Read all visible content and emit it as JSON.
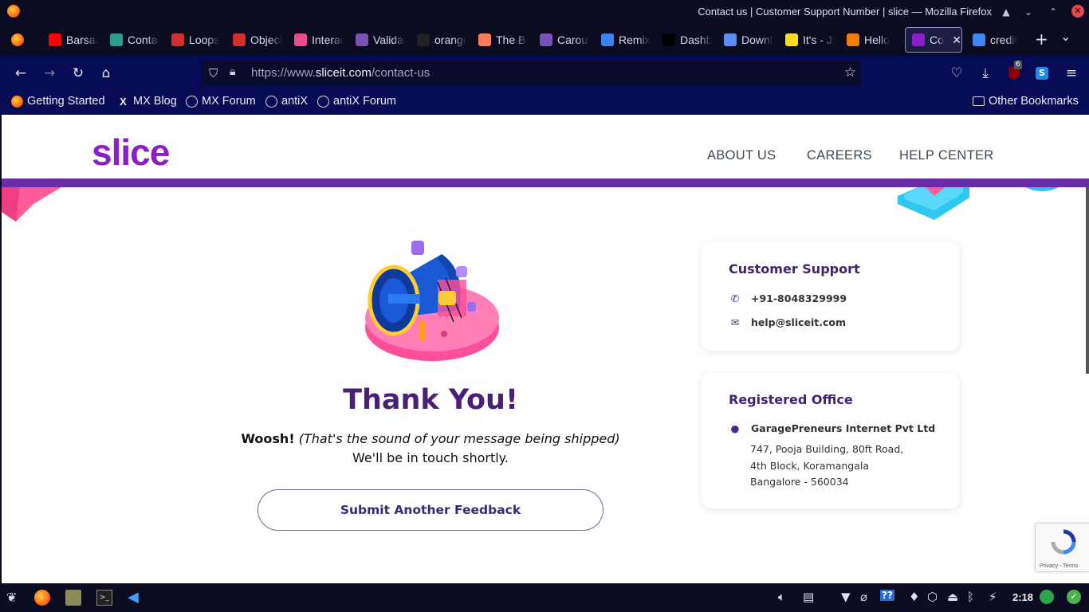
{
  "window": {
    "title": "Contact us | Customer Support Number | slice — Mozilla Firefox",
    "controls": [
      "▲",
      "⌄",
      "⌃",
      "✕"
    ]
  },
  "tabs": [
    {
      "label": "Barsaat",
      "icon": "youtube-icon",
      "color": "#ff0000"
    },
    {
      "label": "Contact",
      "icon": "document-icon",
      "color": "#2a9d8f"
    },
    {
      "label": "Loops",
      "icon": "stickman-icon",
      "color": "#d32f2f"
    },
    {
      "label": "Object",
      "icon": "stickman-icon",
      "color": "#d32f2f"
    },
    {
      "label": "Interactive",
      "icon": "dribbble-icon",
      "color": "#ea4c89"
    },
    {
      "label": "Validation",
      "icon": "bootstrap-icon",
      "color": "#7952b3"
    },
    {
      "label": "orange",
      "icon": "box-icon",
      "color": "#222222"
    },
    {
      "label": "The Best",
      "icon": "hubspot-icon",
      "color": "#ff7a59"
    },
    {
      "label": "Carousel",
      "icon": "bootstrap-icon",
      "color": "#7952b3"
    },
    {
      "label": "Remix",
      "icon": "remix-icon",
      "color": "#3b82f6"
    },
    {
      "label": "Dashboard",
      "icon": "vercel-icon",
      "color": "#000000"
    },
    {
      "label": "Download",
      "icon": "diamond-icon",
      "color": "#5b8def"
    },
    {
      "label": "It's - JS",
      "icon": "js-icon",
      "color": "#f7df1e"
    },
    {
      "label": "Hello",
      "icon": "ag-icon",
      "color": "#f57c00"
    },
    {
      "label": "Contact",
      "icon": "slice-icon",
      "color": "#8b1fc7",
      "active": true
    },
    {
      "label": "credit",
      "icon": "google-icon",
      "color": "#4285f4"
    }
  ],
  "navbar": {
    "url_prefix": "https://www.",
    "url_domain": "sliceit.com",
    "url_path": "/contact-us",
    "ublock_count": "6"
  },
  "bookmarks": [
    {
      "label": "Getting Started",
      "icon": "firefox-icon"
    },
    {
      "label": "MX Blog",
      "icon": "mx-icon"
    },
    {
      "label": "MX Forum",
      "icon": "globe-icon"
    },
    {
      "label": "antiX",
      "icon": "globe-icon"
    },
    {
      "label": "antiX Forum",
      "icon": "globe-icon"
    }
  ],
  "other_bookmarks": "Other Bookmarks",
  "site": {
    "logo": "slice",
    "nav": [
      "ABOUT US",
      "CAREERS",
      "HELP CENTER"
    ],
    "thanks_title": "Thank You!",
    "woosh": "Woosh!",
    "woosh_note": "(That's the sound of your message being shipped)",
    "followup": "We'll be in touch shortly.",
    "feedback_button": "Submit Another Feedback",
    "support": {
      "heading": "Customer Support",
      "phone": "+91-8048329999",
      "email": "help@sliceit.com"
    },
    "office": {
      "heading": "Registered Office",
      "company": "GaragePreneurs Internet Pvt Ltd",
      "line1": "747, Pooja Building, 80ft Road,",
      "line2": "4th Block, Koramangala",
      "line3": "Bangalore - 560034"
    },
    "recaptcha_text": "Privacy - Terms"
  },
  "taskbar": {
    "clock": "2:18",
    "tray_help": "??"
  }
}
